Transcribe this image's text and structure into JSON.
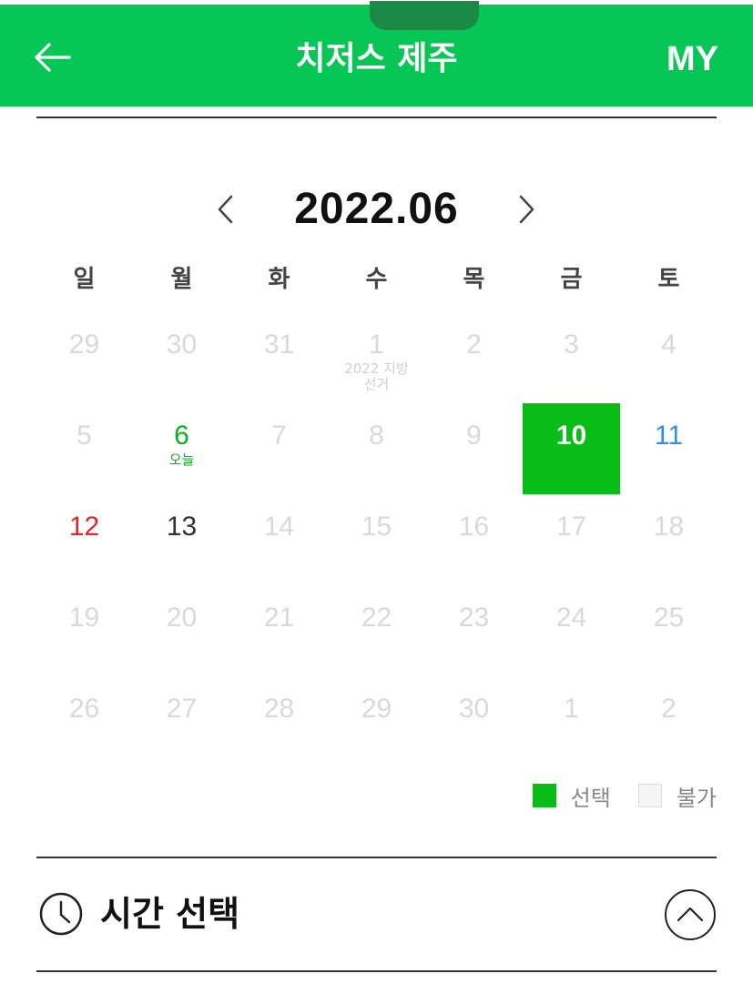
{
  "header": {
    "title": "치저스 제주",
    "my_label": "MY",
    "bg_color": "#06c755"
  },
  "calendar": {
    "month_label": "2022.06",
    "weekdays": [
      "일",
      "월",
      "화",
      "수",
      "목",
      "금",
      "토"
    ],
    "weeks": [
      [
        {
          "day": "29",
          "state": "disabled"
        },
        {
          "day": "30",
          "state": "disabled"
        },
        {
          "day": "31",
          "state": "disabled"
        },
        {
          "day": "1",
          "state": "disabled",
          "note": "2022 지방 선거"
        },
        {
          "day": "2",
          "state": "disabled"
        },
        {
          "day": "3",
          "state": "disabled"
        },
        {
          "day": "4",
          "state": "disabled"
        }
      ],
      [
        {
          "day": "5",
          "state": "disabled"
        },
        {
          "day": "6",
          "state": "today",
          "note": "오늘"
        },
        {
          "day": "7",
          "state": "disabled"
        },
        {
          "day": "8",
          "state": "disabled"
        },
        {
          "day": "9",
          "state": "disabled"
        },
        {
          "day": "10",
          "state": "selected"
        },
        {
          "day": "11",
          "state": "saturday"
        }
      ],
      [
        {
          "day": "12",
          "state": "sunday"
        },
        {
          "day": "13",
          "state": "available"
        },
        {
          "day": "14",
          "state": "disabled"
        },
        {
          "day": "15",
          "state": "disabled"
        },
        {
          "day": "16",
          "state": "disabled"
        },
        {
          "day": "17",
          "state": "disabled"
        },
        {
          "day": "18",
          "state": "disabled"
        }
      ],
      [
        {
          "day": "19",
          "state": "disabled"
        },
        {
          "day": "20",
          "state": "disabled"
        },
        {
          "day": "21",
          "state": "disabled"
        },
        {
          "day": "22",
          "state": "disabled"
        },
        {
          "day": "23",
          "state": "disabled"
        },
        {
          "day": "24",
          "state": "disabled"
        },
        {
          "day": "25",
          "state": "disabled"
        }
      ],
      [
        {
          "day": "26",
          "state": "disabled"
        },
        {
          "day": "27",
          "state": "disabled"
        },
        {
          "day": "28",
          "state": "disabled"
        },
        {
          "day": "29",
          "state": "disabled"
        },
        {
          "day": "30",
          "state": "disabled"
        },
        {
          "day": "1",
          "state": "disabled"
        },
        {
          "day": "2",
          "state": "disabled"
        }
      ]
    ]
  },
  "legend": {
    "selected_label": "선택",
    "unavailable_label": "불가",
    "selected_color": "#09bd17"
  },
  "time_section": {
    "title": "시간 선택"
  },
  "icons": [
    "arrow-left-icon",
    "chevron-left-icon",
    "chevron-right-icon",
    "clock-icon",
    "chevron-up-icon"
  ]
}
